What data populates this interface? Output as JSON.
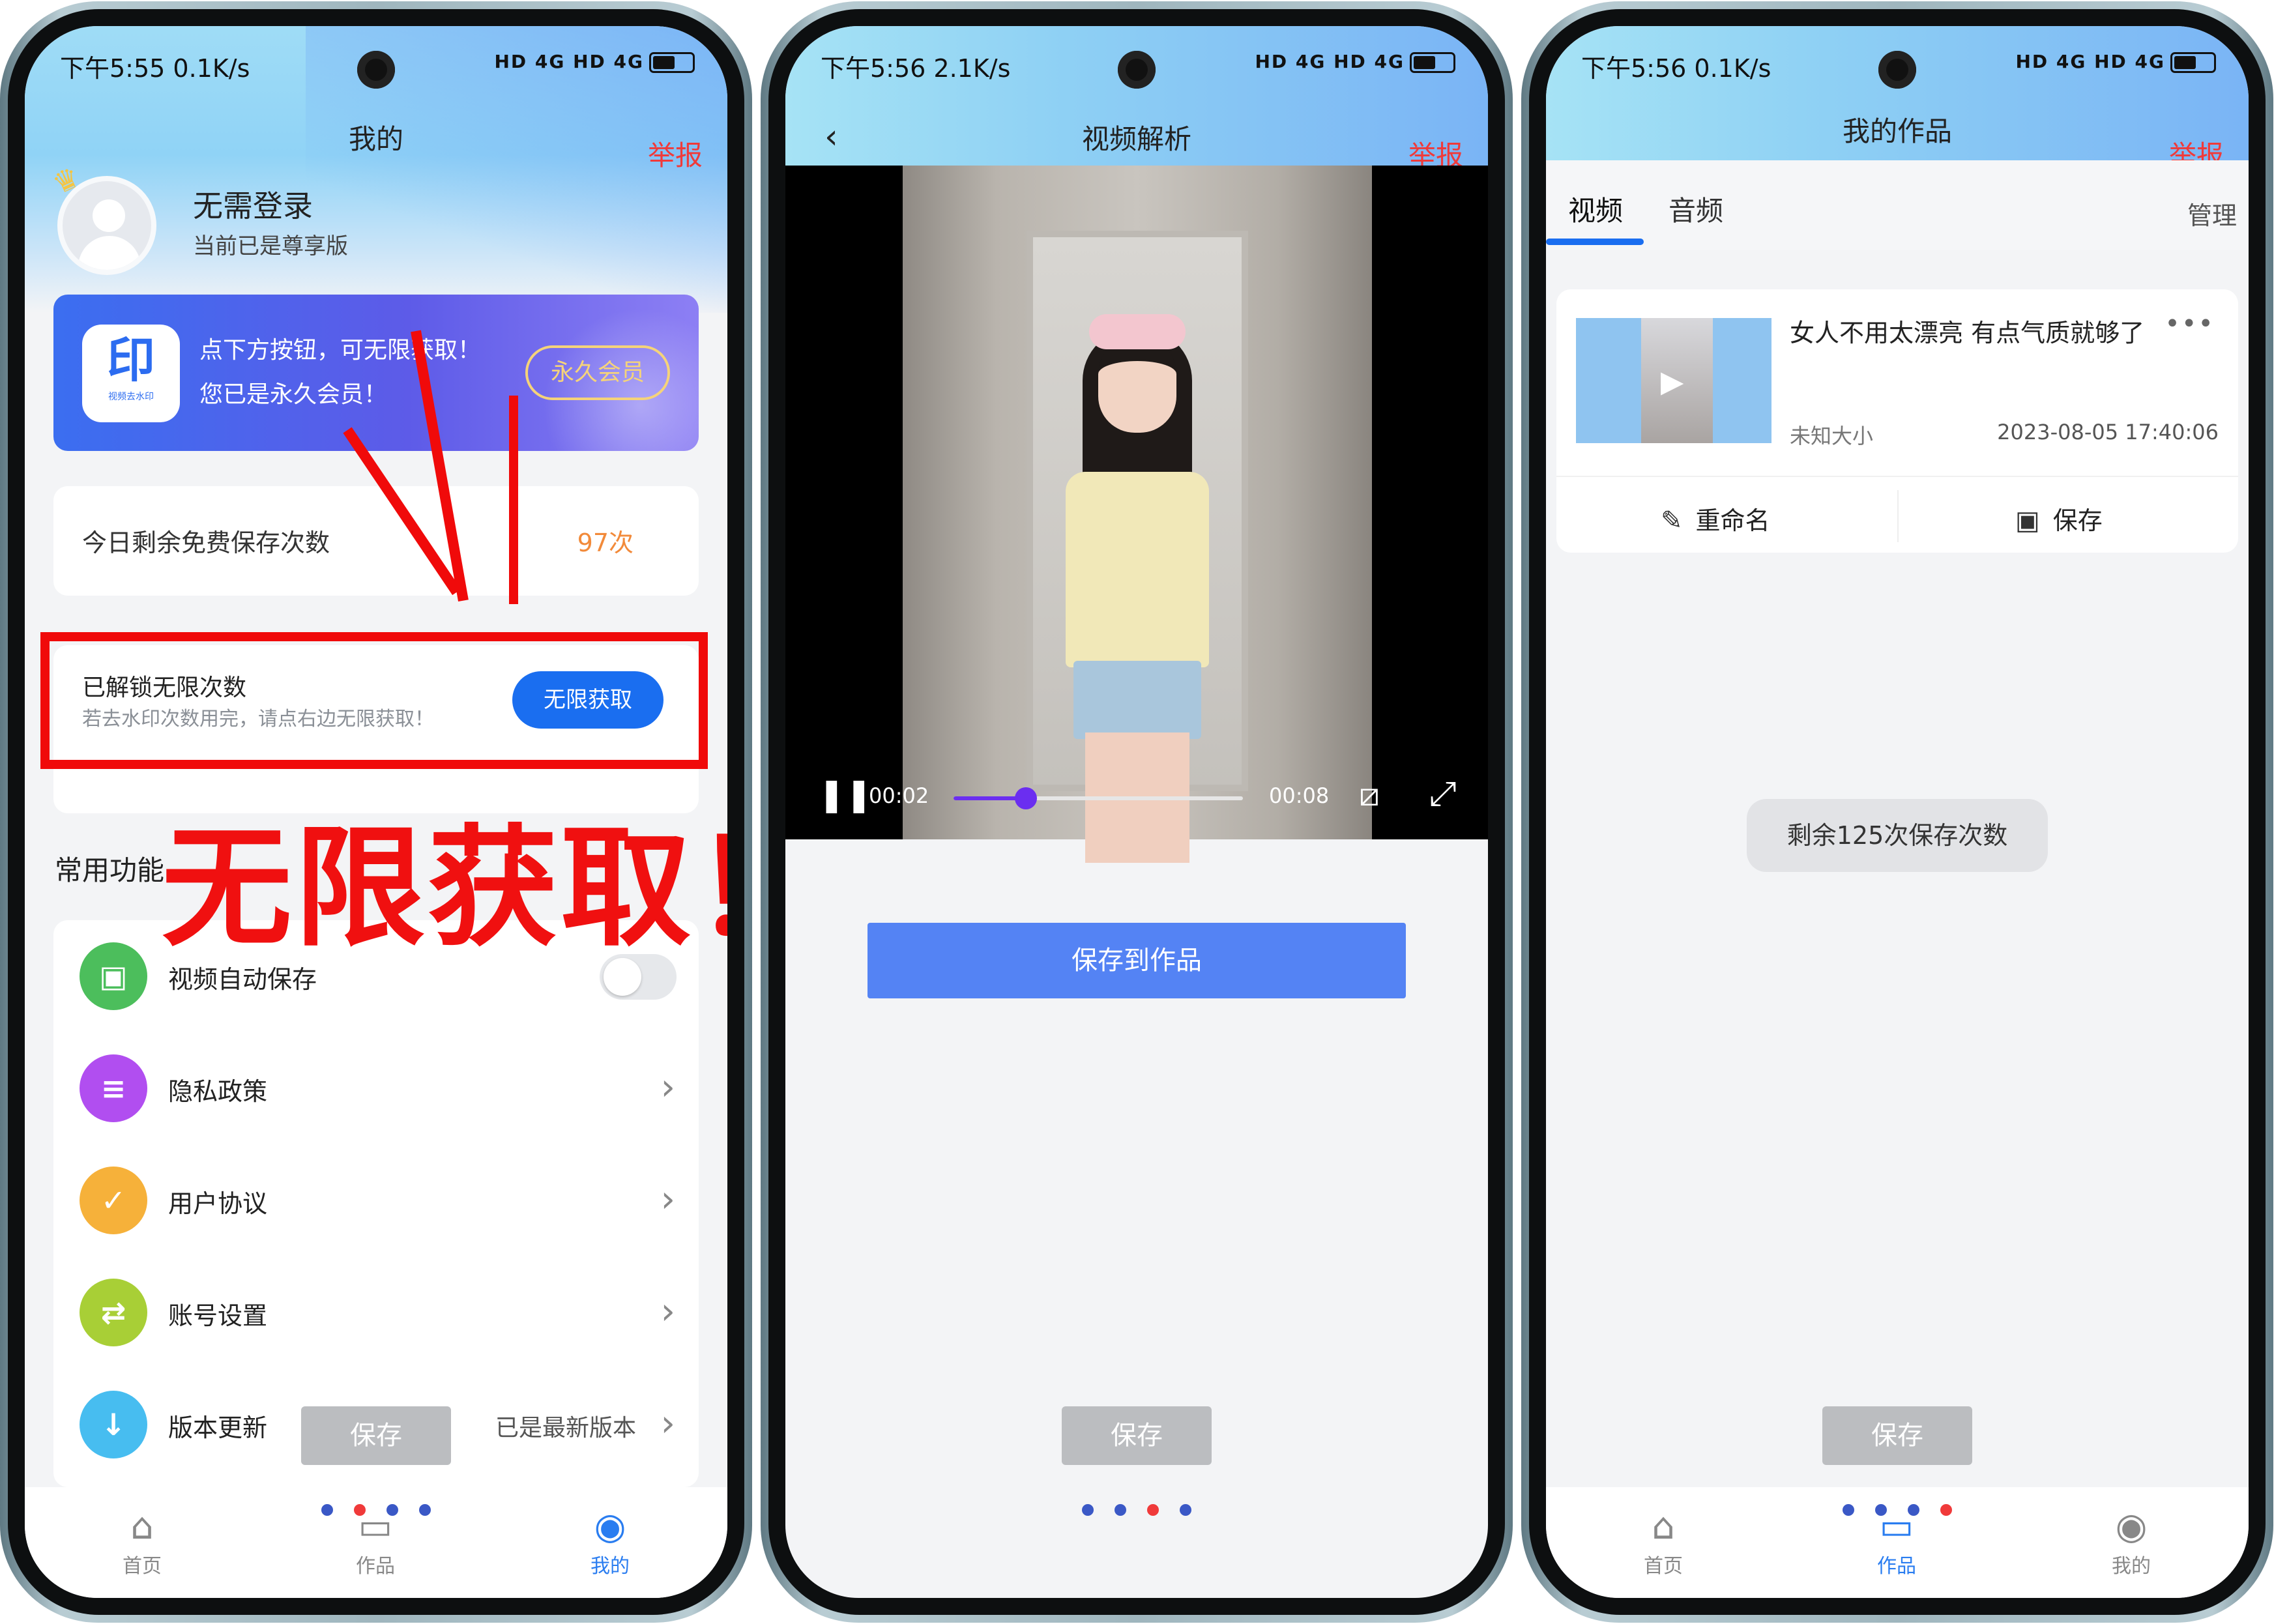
{
  "phones": [
    {
      "status": {
        "time": "下午5:55 0.1K/s",
        "icons": "HD 4G HD 4G",
        "battery": "38%"
      },
      "title": "我的",
      "report": "举报",
      "user": {
        "name": "无需登录",
        "subtitle": "当前已是尊享版"
      },
      "vip_banner": {
        "logo": "印",
        "logo_caption": "视频去水印",
        "line1": "点下方按钮，可无限获取！",
        "line2": "您已是永久会员！",
        "badge": "永久会员"
      },
      "free_count": {
        "label": "今日剩余免费保存次数",
        "value": "97次"
      },
      "unlock": {
        "title": "已解锁无限次数",
        "desc": "若去水印次数用完，请点右边无限获取！",
        "button": "无限获取"
      },
      "overlay_text": "无限获取！！",
      "section_title": "常用功能",
      "menu": [
        {
          "label": "视频自动保存",
          "icon": "save-icon",
          "color": "#4cbe5c"
        },
        {
          "label": "隐私政策",
          "icon": "document-icon",
          "color": "#b14ef0"
        },
        {
          "label": "用户协议",
          "icon": "shield-icon",
          "color": "#f6b13a"
        },
        {
          "label": "账号设置",
          "icon": "settings-icon",
          "color": "#a8cf36"
        },
        {
          "label": "版本更新",
          "icon": "download-icon",
          "color": "#47bdf0",
          "value": "已是最新版本"
        }
      ],
      "ghost_save": "保存",
      "tabs": [
        "首页",
        "作品",
        "我的"
      ],
      "active_tab": "我的"
    },
    {
      "status": {
        "time": "下午5:56 2.1K/s",
        "icons": "HD 4G HD 4G",
        "battery": "38%"
      },
      "title": "视频解析",
      "report": "举报",
      "player": {
        "current": "00:02",
        "duration": "00:08",
        "progress": 0.25
      },
      "save_to_works": "保存到作品",
      "ghost_save": "保存"
    },
    {
      "status": {
        "time": "下午5:56 0.1K/s",
        "icons": "HD 4G HD 4G",
        "battery": "38%"
      },
      "title": "我的作品",
      "report": "举报",
      "tabs_top": [
        "视频",
        "音频"
      ],
      "manage": "管理",
      "work": {
        "title": "女人不用太漂亮 有点气质就够了",
        "size": "未知大小",
        "date": "2023-08-05 17:40:06",
        "rename": "重命名",
        "save": "保存"
      },
      "toast": "剩余125次保存次数",
      "ghost_save": "保存",
      "tabs": [
        "首页",
        "作品",
        "我的"
      ],
      "active_tab": "作品"
    }
  ]
}
